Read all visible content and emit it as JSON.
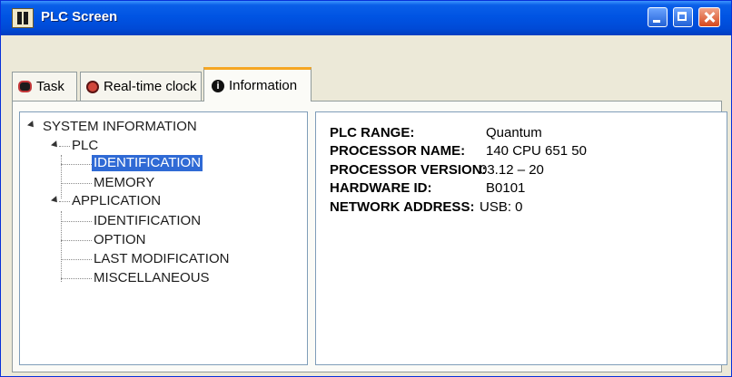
{
  "window": {
    "title": "PLC Screen"
  },
  "tabs": [
    {
      "label": "Task",
      "icon": "task-icon"
    },
    {
      "label": "Real-time clock",
      "icon": "clock-icon"
    },
    {
      "label": "Information",
      "icon": "info-icon",
      "active": true
    }
  ],
  "tree": {
    "root": "SYSTEM INFORMATION",
    "plc": {
      "label": "PLC",
      "children": [
        "IDENTIFICATION",
        "MEMORY"
      ]
    },
    "application": {
      "label": "APPLICATION",
      "children": [
        "IDENTIFICATION",
        "OPTION",
        "LAST MODIFICATION",
        "MISCELLANEOUS"
      ]
    },
    "selected": "PLC > IDENTIFICATION"
  },
  "info": [
    {
      "label": "PLC RANGE:",
      "value": "Quantum"
    },
    {
      "label": "PROCESSOR NAME:",
      "value": "140 CPU 651 50"
    },
    {
      "label": "PROCESSOR VERSION:",
      "value": "03.12 – 20"
    },
    {
      "label": "HARDWARE ID:",
      "value": "B0101"
    },
    {
      "label": "NETWORK ADDRESS:",
      "value": "USB: 0"
    }
  ],
  "colors": {
    "titlebar": "#0054e3",
    "selection": "#2f6ad5",
    "active_tab_accent": "#f5a623"
  }
}
